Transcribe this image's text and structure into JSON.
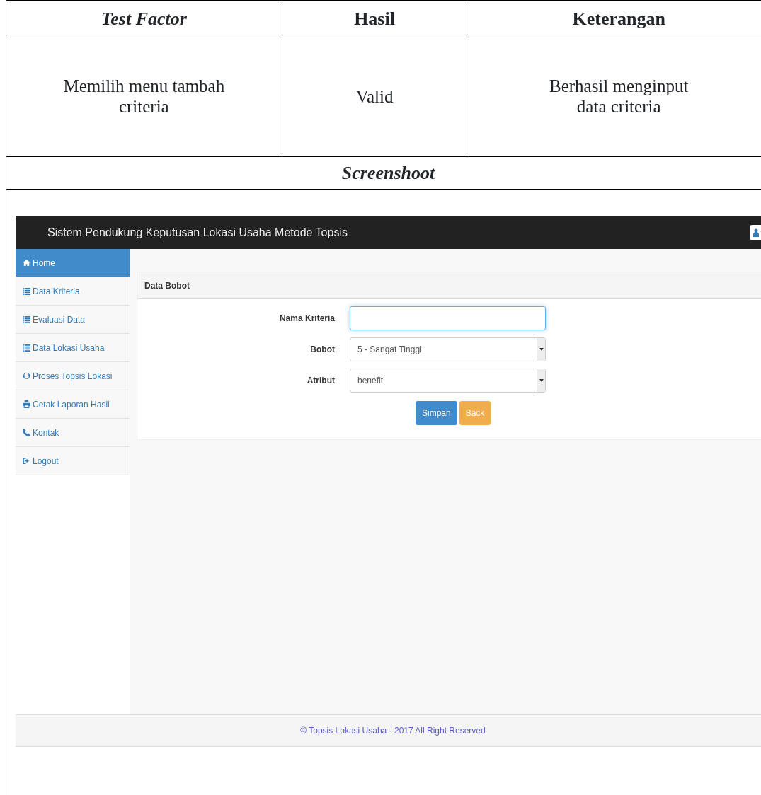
{
  "table": {
    "columns": [
      {
        "label": "Test Factor",
        "italic": true
      },
      {
        "label": "Hasil",
        "italic": false
      },
      {
        "label": "Keterangan",
        "italic": false
      }
    ],
    "rows": [
      [
        "Memilih menu tambah criteria",
        "Valid",
        "Berhasil menginput data criteria"
      ]
    ],
    "section_title": "Screenshoot"
  },
  "app": {
    "title": "Sistem Pendukung Keputusan Lokasi Usaha Metode Topsis",
    "sidebar": {
      "items": [
        {
          "label": "Home",
          "kind": "home",
          "selected": true
        },
        {
          "label": "Data Kriteria",
          "kind": "list",
          "selected": false
        },
        {
          "label": "Evaluasi Data",
          "kind": "list",
          "selected": false
        },
        {
          "label": "Data Lokasi Usaha",
          "kind": "list",
          "selected": false
        },
        {
          "label": "Proses Topsis Lokasi",
          "kind": "refresh",
          "selected": false
        },
        {
          "label": "Cetak Laporan Hasil",
          "kind": "print",
          "selected": false
        },
        {
          "label": "Kontak",
          "kind": "phone",
          "selected": false
        },
        {
          "label": "Logout",
          "kind": "logout",
          "selected": false
        }
      ]
    },
    "panel": {
      "title": "Data Bobot",
      "fields": [
        {
          "label": "Nama Kriteria",
          "kind": "text"
        },
        {
          "label": "Bobot",
          "kind": "select",
          "value": "5 - Sangat Tinggi"
        },
        {
          "label": "Atribut",
          "kind": "select",
          "value": "benefit"
        }
      ],
      "buttons": [
        {
          "label": "Simpan",
          "kind": "primary"
        },
        {
          "label": "Back",
          "kind": "warning"
        }
      ]
    },
    "footer": "© Topsis Lokasi Usaha - 2017 All Right Reserved"
  }
}
